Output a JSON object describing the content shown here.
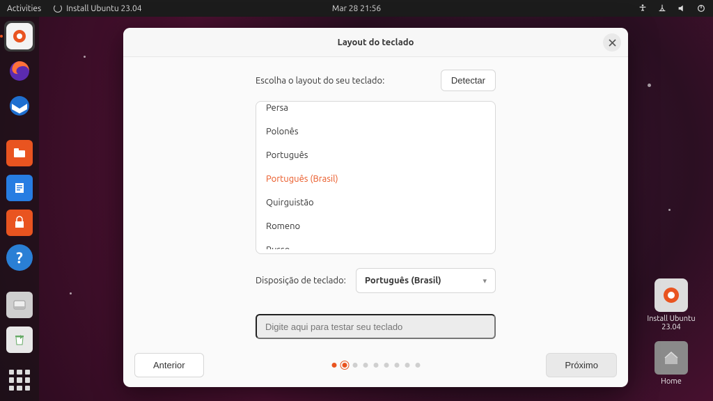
{
  "topbar": {
    "activities": "Activities",
    "app_indicator": "Install Ubuntu 23.04",
    "clock": "Mar 28  21:56"
  },
  "dock": {
    "items": [
      {
        "name": "installer",
        "active": true,
        "bg": "#f5f5f5"
      },
      {
        "name": "firefox",
        "bg": "#ff7139"
      },
      {
        "name": "thunderbird",
        "bg": "#1f6fd0"
      },
      {
        "name": "files",
        "bg": "#e95420"
      },
      {
        "name": "writer",
        "bg": "#277de2"
      },
      {
        "name": "software",
        "bg": "#e95420"
      },
      {
        "name": "help",
        "bg": "#2a7fd5"
      },
      {
        "name": "disk",
        "bg": "#c8c8c8"
      },
      {
        "name": "trash",
        "bg": "#dedede"
      }
    ]
  },
  "desktop": {
    "install": {
      "label1": "Install Ubuntu",
      "label2": "23.04"
    },
    "home": {
      "label": "Home"
    }
  },
  "installer": {
    "title": "Layout do teclado",
    "prompt": "Escolha o layout do seu teclado:",
    "detect": "Detectar",
    "layouts": [
      "Persa",
      "Polonês",
      "Português",
      "Português (Brasil)",
      "Quirguistão",
      "Romeno",
      "Russo"
    ],
    "selected_layout": "Português (Brasil)",
    "variant_label": "Disposição de teclado:",
    "variant_value": "Português (Brasil)",
    "test_placeholder": "Digite aqui para testar seu teclado",
    "back": "Anterior",
    "next": "Próximo",
    "step_current": 1,
    "step_total": 9
  }
}
